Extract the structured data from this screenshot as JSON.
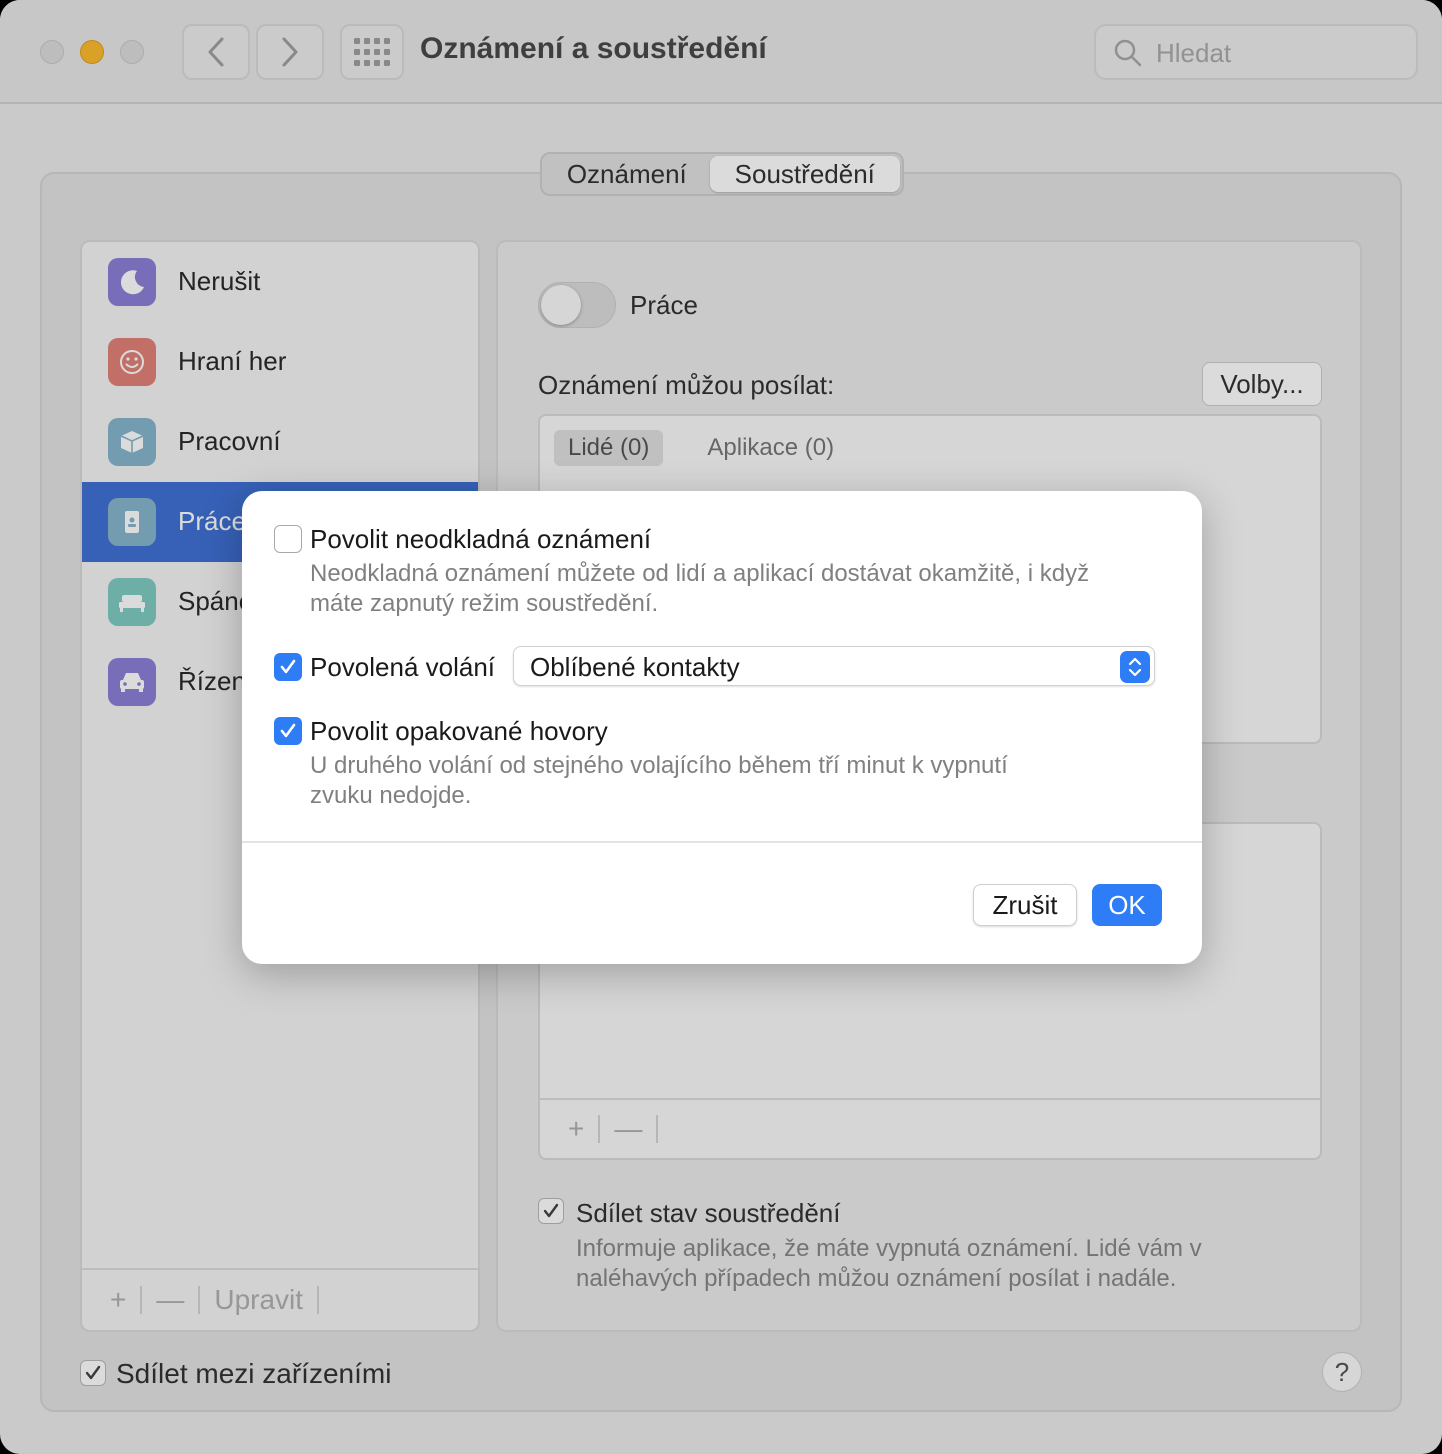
{
  "window": {
    "title": "Oznámení a soustředění",
    "search_placeholder": "Hledat"
  },
  "tabs": [
    {
      "label": "Oznámení",
      "active": false
    },
    {
      "label": "Soustředění",
      "active": true
    }
  ],
  "sidebar": {
    "items": [
      {
        "label": "Nerušit",
        "icon": "moon-icon",
        "color": "#8b7fd8"
      },
      {
        "label": "Hraní her",
        "icon": "smiley-icon",
        "color": "#e2827a"
      },
      {
        "label": "Pracovní",
        "icon": "cube-icon",
        "color": "#86b6cf"
      },
      {
        "label": "Práce",
        "icon": "id-badge-icon",
        "color": "#86b6cf",
        "selected": true
      },
      {
        "label": "Spánek",
        "icon": "bed-icon",
        "color": "#7fcbc2"
      },
      {
        "label": "Řízení",
        "icon": "car-icon",
        "color": "#8b7fd8"
      }
    ],
    "footer": {
      "add": "+",
      "remove": "—",
      "edit": "Upravit"
    }
  },
  "main": {
    "focus_name": "Práce",
    "toggle_on": false,
    "allowed_label": "Oznámení můžou posílat:",
    "options_button": "Volby...",
    "list_tabs": [
      {
        "label": "Lidé (0)",
        "active": true
      },
      {
        "label": "Aplikace (0)",
        "active": false
      }
    ],
    "list2_footer": {
      "add": "+",
      "remove": "—"
    },
    "share_status": {
      "checked": true,
      "label": "Sdílet stav soustředění",
      "desc": "Informuje aplikace, že máte vypnutá oznámení. Lidé vám v naléhavých případech můžou oznámení posílat i nadále."
    }
  },
  "footer": {
    "share_devices": {
      "checked": true,
      "label": "Sdílet mezi zařízeními"
    },
    "help": "?"
  },
  "sheet": {
    "time_sensitive": {
      "checked": false,
      "label": "Povolit neodkladná oznámení",
      "desc_line1": "Neodkladná oznámení můžete od lidí a aplikací dostávat okamžitě, i když",
      "desc_line2": "máte zapnutý režim soustředění."
    },
    "allowed_calls": {
      "checked": true,
      "label": "Povolená volání",
      "selected": "Oblíbené kontakty"
    },
    "repeated_calls": {
      "checked": true,
      "label": "Povolit opakované hovory",
      "desc_line1": "U druhého volání od stejného volajícího během tří minut k vypnutí",
      "desc_line2": "zvuku nedojde."
    },
    "cancel_label": "Zrušit",
    "ok_label": "OK",
    "accent_color": "#2e7cf6"
  }
}
